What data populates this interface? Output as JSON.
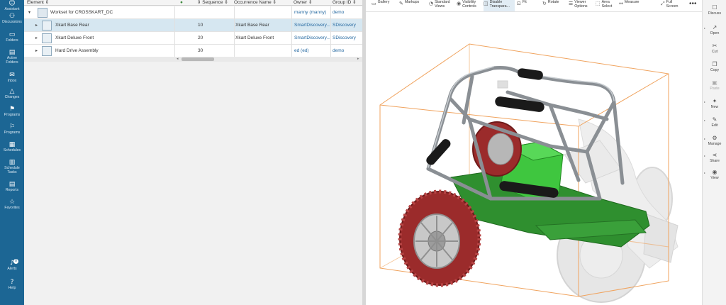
{
  "nav": {
    "items": [
      {
        "icon": "assistant-icon",
        "label": "Assistant"
      },
      {
        "icon": "discussions-icon",
        "label": "Discussions"
      },
      {
        "icon": "folders-icon",
        "label": "Folders"
      },
      {
        "icon": "active-folders-icon",
        "label": "Active Folders"
      },
      {
        "icon": "inbox-icon",
        "label": "Inbox"
      },
      {
        "icon": "changes-icon",
        "label": "Changes"
      },
      {
        "icon": "programs-icon",
        "label": "Programs"
      },
      {
        "icon": "programs-alt-icon",
        "label": "Programs"
      },
      {
        "icon": "schedules-icon",
        "label": "Schedules"
      },
      {
        "icon": "schedule-tasks-icon",
        "label": "Schedule Tasks"
      },
      {
        "icon": "reports-icon",
        "label": "Reports"
      },
      {
        "icon": "favorites-icon",
        "label": "Favorites"
      }
    ],
    "alerts": {
      "label": "Alerts",
      "count": "0"
    },
    "help": {
      "label": "Help"
    }
  },
  "table": {
    "columns": [
      "Element",
      "Sequence",
      "Occurrence Name",
      "Owner",
      "Group ID"
    ],
    "rows": [
      {
        "element": "Workset for CROSSKART_DC",
        "sequence": "",
        "occurrence": "",
        "owner": "manny (manny)",
        "group": "demo",
        "expander": "▾",
        "selected": false
      },
      {
        "element": "Xkart Base Rear",
        "sequence": "10",
        "occurrence": "Xkart Base Rear",
        "owner": "SmartDiscovery...",
        "group": "SDiscovery",
        "expander": "▸",
        "selected": true
      },
      {
        "element": "Xkart Deluxe Front",
        "sequence": "20",
        "occurrence": "Xkart Deluxe Front",
        "owner": "SmartDiscovery...",
        "group": "SDiscovery",
        "expander": "▸",
        "selected": false
      },
      {
        "element": "Hard Drive Assembly",
        "sequence": "30",
        "occurrence": "",
        "owner": "ed (ed)",
        "group": "demo",
        "expander": "▸",
        "selected": false
      }
    ]
  },
  "viewer_toolbar": {
    "items": [
      {
        "icon": "gallery-icon",
        "label": "Gallery"
      },
      {
        "icon": "markups-icon",
        "label": "Markups"
      },
      {
        "icon": "standard-views-icon",
        "label": "Standard Views"
      },
      {
        "icon": "visibility-controls-icon",
        "label": "Visibility Controls"
      },
      {
        "icon": "disable-transparency-icon",
        "label": "Disable Transpara..."
      },
      {
        "icon": "fit-icon",
        "label": "Fit"
      },
      {
        "icon": "rotate-icon",
        "label": "Rotate"
      },
      {
        "icon": "viewer-options-icon",
        "label": "Viewer Options"
      },
      {
        "icon": "area-select-icon",
        "label": "Area Select"
      },
      {
        "icon": "measure-icon",
        "label": "Measure"
      },
      {
        "icon": "full-screen-icon",
        "label": "Full Screen"
      }
    ],
    "more": "•••"
  },
  "commands": {
    "items": [
      {
        "icon": "discuss-icon",
        "label": "Discuss",
        "enabled": true
      },
      {
        "icon": "open-icon",
        "label": "Open",
        "enabled": true
      },
      {
        "icon": "cut-icon",
        "label": "Cut",
        "enabled": true
      },
      {
        "icon": "copy-icon",
        "label": "Copy",
        "enabled": true
      },
      {
        "icon": "paste-icon",
        "label": "Paste",
        "enabled": false
      },
      {
        "icon": "new-icon",
        "label": "New",
        "enabled": true
      },
      {
        "icon": "edit-icon",
        "label": "Edit",
        "enabled": true
      },
      {
        "icon": "manage-icon",
        "label": "Manage",
        "enabled": true
      },
      {
        "icon": "share-icon",
        "label": "Share",
        "enabled": true
      },
      {
        "icon": "view-icon",
        "label": "View",
        "enabled": true
      }
    ]
  },
  "colors": {
    "nav_bg": "#1c6694",
    "selection": "#d6e7f1",
    "link": "#2569a1",
    "bounding_box": "#f0a35e",
    "tire": "#9b2b2b",
    "chassis": "#3aa03a",
    "frame": "#8a8f94"
  }
}
